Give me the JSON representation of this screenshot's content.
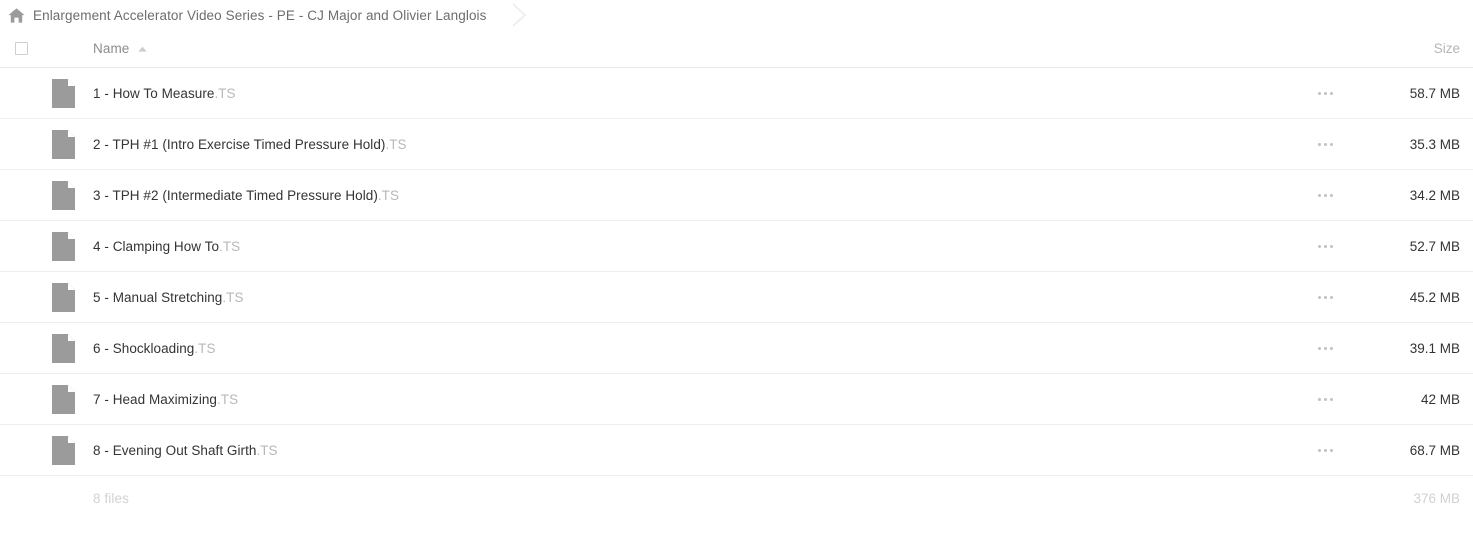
{
  "breadcrumb": {
    "home_icon": "home-icon",
    "path_label": "Enlargement Accelerator Video Series - PE - CJ Major and Olivier Langlois",
    "separator_icon": "chevron-right-icon"
  },
  "table": {
    "header": {
      "select_all_checkbox": "checkbox-unchecked-icon",
      "name_label": "Name",
      "sort_icon": "sort-ascending-icon",
      "size_label": "Size"
    },
    "row_menu_icon": "ellipsis-icon",
    "file_icon": "file-document-icon",
    "rows": [
      {
        "name": "1 - How To Measure",
        "ext": ".TS",
        "size": "58.7 MB"
      },
      {
        "name": "2 - TPH #1 (Intro Exercise Timed Pressure Hold)",
        "ext": ".TS",
        "size": "35.3 MB"
      },
      {
        "name": "3 - TPH #2 (Intermediate Timed Pressure Hold)",
        "ext": ".TS",
        "size": "34.2 MB"
      },
      {
        "name": "4 - Clamping How To",
        "ext": ".TS",
        "size": "52.7 MB"
      },
      {
        "name": "5 - Manual Stretching",
        "ext": ".TS",
        "size": "45.2 MB"
      },
      {
        "name": "6 - Shockloading",
        "ext": ".TS",
        "size": "39.1 MB"
      },
      {
        "name": "7 - Head Maximizing",
        "ext": ".TS",
        "size": "42 MB"
      },
      {
        "name": "8 - Evening Out Shaft Girth",
        "ext": ".TS",
        "size": "68.7 MB"
      }
    ],
    "footer": {
      "count_label": "8 files",
      "total_size": "376 MB"
    }
  },
  "colors": {
    "background": "#ffffff",
    "icon_gray": "#9b9b9b",
    "text_primary": "#343434",
    "text_muted": "#8c8c8c",
    "text_faint": "#d2d2d2",
    "extension_gray": "#b8b8b8",
    "row_border": "#eeeeee"
  }
}
